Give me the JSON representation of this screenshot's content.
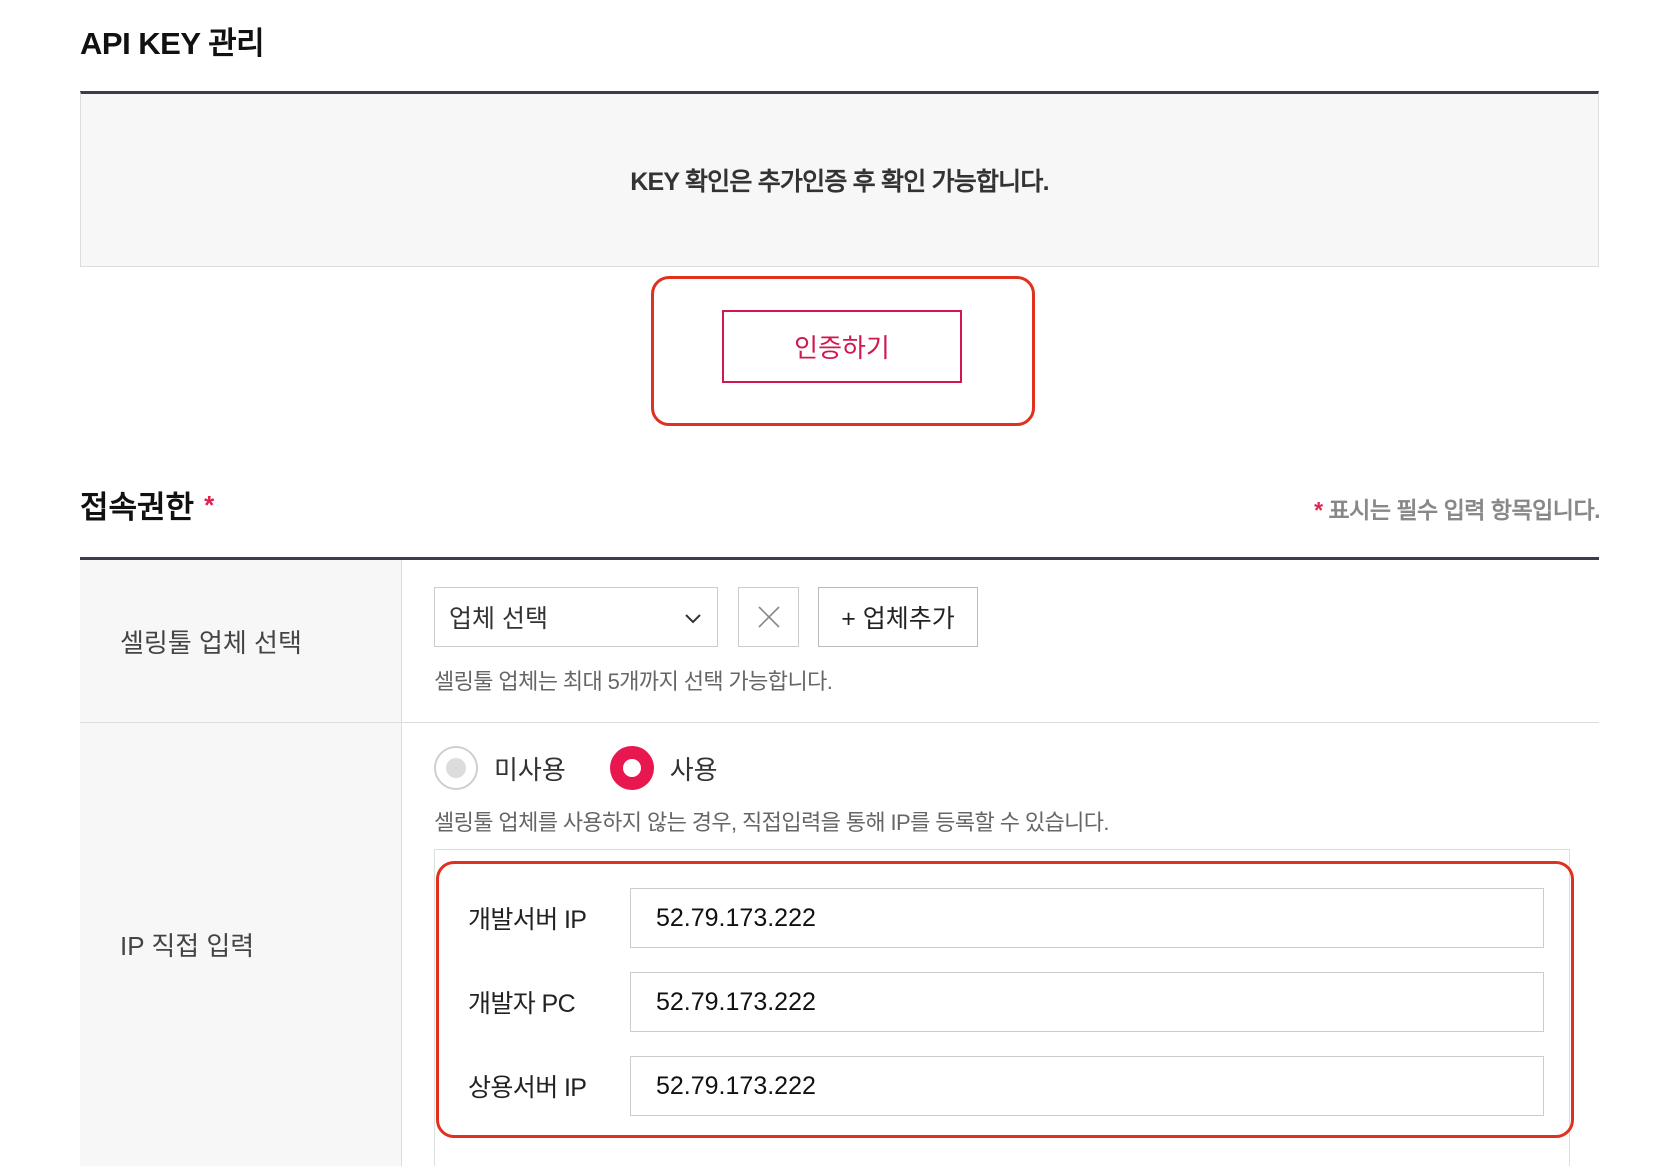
{
  "header": {
    "title": "API KEY 관리"
  },
  "key_notice": {
    "text": "KEY 확인은 추가인증 후 확인 가능합니다."
  },
  "auth": {
    "button_label": "인증하기"
  },
  "access": {
    "title": "접속권한",
    "required_star": "*",
    "required_note": "표시는 필수 입력 항목입니다.",
    "required_note_star": "*"
  },
  "seller": {
    "label": "셀링툴 업체 선택",
    "select_value": "업체 선택",
    "add_label": "+ 업체추가",
    "help": "셀링툴 업체는 최대 5개까지 선택 가능합니다."
  },
  "ip_direct": {
    "label": "IP 직접 입력",
    "options": [
      {
        "label": "미사용",
        "selected": false
      },
      {
        "label": "사용",
        "selected": true
      }
    ],
    "help": "셀링툴 업체를 사용하지 않는 경우, 직접입력을 통해 IP를 등록할 수 있습니다.",
    "fields": [
      {
        "label": "개발서버 IP",
        "value": "52.79.173.222"
      },
      {
        "label": "개발자 PC",
        "value": "52.79.173.222"
      },
      {
        "label": "상용서버 IP",
        "value": "52.79.173.222"
      }
    ]
  },
  "colors": {
    "accent": "#d0174e",
    "radio_active": "#e8174f",
    "highlight": "#e0301e",
    "header_border": "#3b3d4a"
  }
}
